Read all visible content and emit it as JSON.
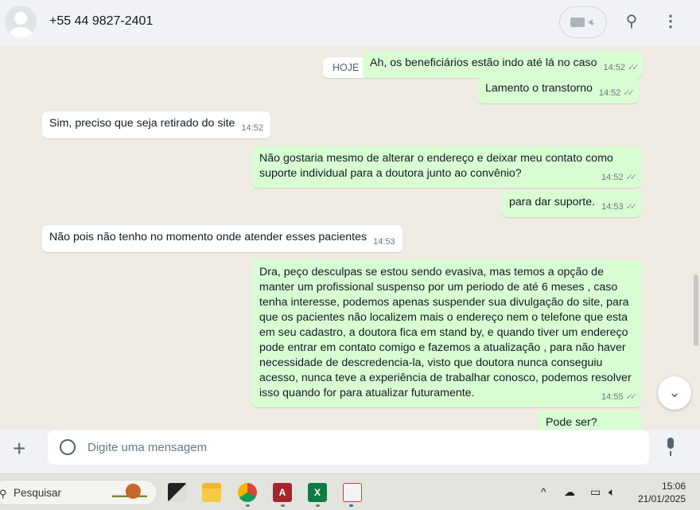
{
  "header": {
    "contact": "+55 44 9827-2401",
    "video_caret": "⌄"
  },
  "date_divider": "HOJE",
  "messages": [
    {
      "dir": "out",
      "text": "Ah, os beneficiários estão indo até lá no caso",
      "time": "14:52"
    },
    {
      "dir": "out",
      "text": "Lamento o transtorno",
      "time": "14:52"
    },
    {
      "dir": "in",
      "text": "Sim, preciso que seja retirado do site",
      "time": "14:52"
    },
    {
      "dir": "out",
      "text": "Não gostaria mesmo de alterar o endereço e deixar meu contato como suporte individual para a doutora junto ao convênio?",
      "time": "14:52"
    },
    {
      "dir": "out",
      "text": "para dar suporte.",
      "time": "14:53"
    },
    {
      "dir": "in",
      "text": "Não pois não tenho no momento onde atender esses pacientes",
      "time": "14:53"
    },
    {
      "dir": "out",
      "text": "Dra, peço desculpas se estou sendo evasiva, mas temos a opção de manter um profissional suspenso por um periodo de até 6 meses , caso tenha interesse, podemos apenas suspender sua divulgação do site, para que os pacientes não localizem mais o endereço nem o telefone que esta em seu cadastro, a doutora fica em stand by, e quando tiver um endereço pode entrar em contato comigo e fazemos  a atualização , para não haver necessidade de descredencia-la, visto que doutora nunca conseguiu acesso, nunca teve a experiência de trabalhar conosco, podemos resolver isso quando for para atualizar futuramente.",
      "time": "14:55"
    },
    {
      "dir": "out",
      "text": "Pode ser?",
      "time": ""
    }
  ],
  "composer": {
    "placeholder": "Digite uma mensagem"
  },
  "taskbar": {
    "search": "Pesquisar",
    "time": "15:06",
    "date": "21/01/2025"
  },
  "colors": {
    "outgoing": "#d9fdd3",
    "incoming": "#ffffff",
    "chat_bg": "#efeae2"
  }
}
